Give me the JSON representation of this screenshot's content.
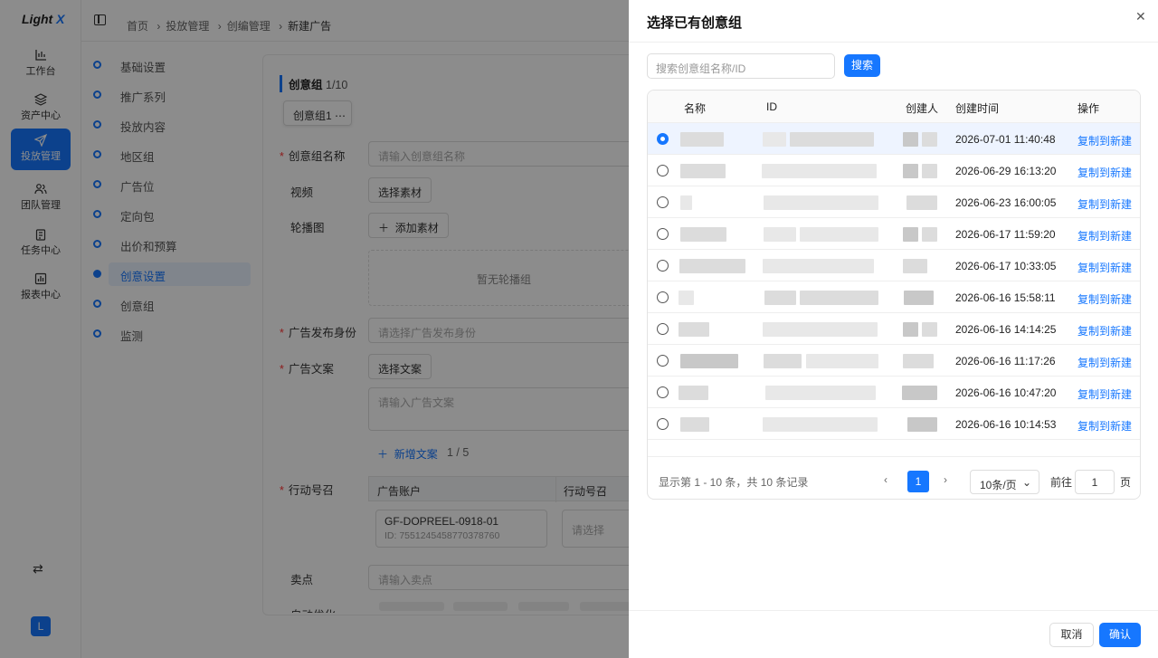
{
  "app": {
    "logo_text": "Light",
    "logo_accent": "X",
    "accent_color": "#1677ff"
  },
  "rail": {
    "items": [
      {
        "label": "工作台",
        "icon": "bar-chart-icon"
      },
      {
        "label": "资产中心",
        "icon": "layers-icon"
      },
      {
        "label": "投放管理",
        "icon": "send-icon",
        "active": true
      },
      {
        "label": "团队管理",
        "icon": "users-icon"
      },
      {
        "label": "任务中心",
        "icon": "clipboard-icon"
      },
      {
        "label": "报表中心",
        "icon": "report-icon"
      }
    ],
    "swap_icon": "⇄",
    "avatar": "L"
  },
  "breadcrumb": [
    "首页",
    "投放管理",
    "创编管理",
    "新建广告"
  ],
  "steps": [
    "基础设置",
    "推广系列",
    "投放内容",
    "地区组",
    "广告位",
    "定向包",
    "出价和预算",
    "创意设置",
    "创意组",
    "监测"
  ],
  "form": {
    "group_title": "创意组",
    "group_count": "1/10",
    "group_tab": "创意组1",
    "group_name_label": "创意组名称",
    "group_name_placeholder": "请输入创意组名称",
    "video_label": "视频",
    "video_button": "选择素材",
    "carousel_label": "轮播图",
    "carousel_button": "添加素材",
    "carousel_empty": "暂无轮播组",
    "publisher_label": "广告发布身份",
    "publisher_placeholder": "请选择广告发布身份",
    "copy_label": "广告文案",
    "copy_button": "选择文案",
    "copy_placeholder": "请输入广告文案",
    "add_copy": "新增文案",
    "copy_count": "1 / 5",
    "cta_label": "行动号召",
    "cta_col_account": "广告账户",
    "cta_col_cta": "行动号召",
    "account_name": "GF-DOPREEL-0918-01",
    "account_id": "ID: 7551245458770378760",
    "cta_placeholder": "请选择",
    "selling_label": "卖点",
    "selling_placeholder": "请输入卖点",
    "auto_label": "自动优化"
  },
  "drawer": {
    "title": "选择已有创意组",
    "search_placeholder": "搜索创意组名称/ID",
    "search_button": "搜索",
    "columns": [
      "名称",
      "ID",
      "创建人",
      "创建时间",
      "操作"
    ],
    "rows": [
      {
        "time": "2026-07-01 11:40:48",
        "action": "复制到新建",
        "selected": true
      },
      {
        "time": "2026-06-29 16:13:20",
        "action": "复制到新建"
      },
      {
        "time": "2026-06-23 16:00:05",
        "action": "复制到新建"
      },
      {
        "time": "2026-06-17 11:59:20",
        "action": "复制到新建"
      },
      {
        "time": "2026-06-17 10:33:05",
        "action": "复制到新建"
      },
      {
        "time": "2026-06-16 15:58:11",
        "action": "复制到新建"
      },
      {
        "time": "2026-06-16 14:14:25",
        "action": "复制到新建"
      },
      {
        "time": "2026-06-16 11:17:26",
        "action": "复制到新建"
      },
      {
        "time": "2026-06-16 10:47:20",
        "action": "复制到新建"
      },
      {
        "time": "2026-06-16 10:14:53",
        "action": "复制到新建"
      }
    ],
    "pager_summary": "显示第 1 - 10 条，共 10 条记录",
    "current_page": "1",
    "page_size": "10条/页",
    "goto_label": "前往",
    "goto_value": "1",
    "page_unit": "页",
    "cancel": "取消",
    "confirm": "确认"
  }
}
